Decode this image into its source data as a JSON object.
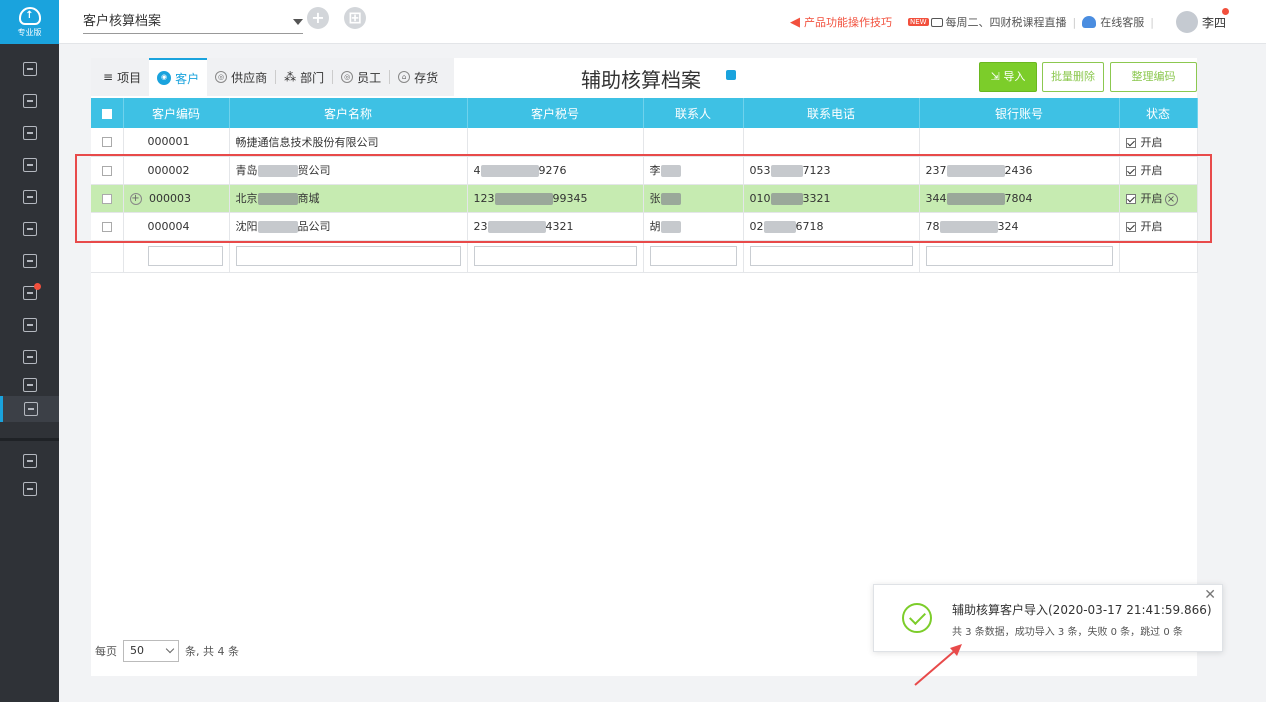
{
  "brand": {
    "text": "专业版"
  },
  "topbar": {
    "page_select": "客户核算档案",
    "tips": "产品功能操作技巧",
    "new_badge": "NEW",
    "live": "每周二、四财税课程直播",
    "service": "在线客服",
    "user": "李四"
  },
  "tabs": [
    {
      "label": "项目",
      "icon": "list-icon"
    },
    {
      "label": "客户",
      "icon": "customer-icon"
    },
    {
      "label": "供应商",
      "icon": "supplier-icon"
    },
    {
      "label": "部门",
      "icon": "department-icon"
    },
    {
      "label": "员工",
      "icon": "employee-icon"
    },
    {
      "label": "存货",
      "icon": "inventory-icon"
    }
  ],
  "title": "辅助核算档案",
  "actions": {
    "import": "导入",
    "batch_delete": "批量删除",
    "sort_code": "整理编码"
  },
  "table": {
    "columns": [
      "客户编码",
      "客户名称",
      "客户税号",
      "联系人",
      "联系电话",
      "银行账号",
      "状态"
    ],
    "rows": [
      {
        "code": "000001",
        "name": "畅捷通信息技术股份有限公司",
        "tax_a": "",
        "tax_b": "",
        "contact": "",
        "phone_a": "",
        "phone_b": "",
        "bank_a": "",
        "bank_b": "",
        "status": "开启"
      },
      {
        "code": "000002",
        "name_a": "青岛",
        "name_b": "贸公司",
        "tax_a": "4",
        "tax_b": "9276",
        "contact": "李",
        "phone_a": "053",
        "phone_b": "7123",
        "bank_a": "237",
        "bank_b": "2436",
        "status": "开启"
      },
      {
        "code": "000003",
        "name_a": "北京",
        "name_b": "商城",
        "tax_a": "123",
        "tax_b": "99345",
        "contact": "张",
        "phone_a": "010",
        "phone_b": "3321",
        "bank_a": "344",
        "bank_b": "7804",
        "status": "开启"
      },
      {
        "code": "000004",
        "name_a": "沈阳",
        "name_b": "品公司",
        "tax_a": "23",
        "tax_b": "4321",
        "contact": "胡",
        "phone_a": "02",
        "phone_b": "6718",
        "bank_a": "78",
        "bank_b": "324",
        "status": "开启"
      }
    ]
  },
  "pager": {
    "per_page_label": "每页",
    "per_page": "50",
    "total": "条, 共 4 条"
  },
  "toast": {
    "title": "辅助核算客户导入(2020-03-17 21:41:59.866)",
    "body": "共 3 条数据，成功导入 3 条，失败 0 条，跳过 0 条"
  },
  "colors": {
    "accent": "#1aa3dd",
    "header": "#3ec1e4",
    "success": "#7ccd2a",
    "highlight_row": "#c6ebb1",
    "annotation": "#e84a4a"
  }
}
